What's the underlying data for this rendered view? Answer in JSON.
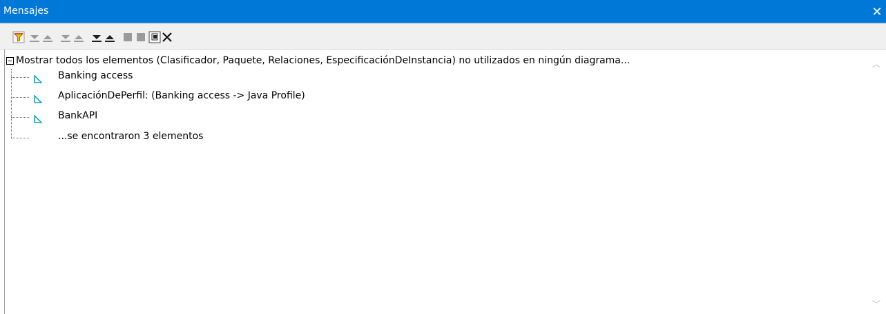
{
  "window": {
    "title": "Mensajes",
    "close_glyph": "✕"
  },
  "toolbar": {
    "buttons": [
      {
        "name": "filter-icon",
        "state": "enabled"
      },
      {
        "name": "next-message-icon",
        "state": "disabled"
      },
      {
        "name": "previous-message-icon",
        "state": "disabled"
      },
      {
        "name": "next-error-icon",
        "state": "disabled"
      },
      {
        "name": "previous-error-icon",
        "state": "disabled"
      },
      {
        "name": "next-warning-icon",
        "state": "enabled"
      },
      {
        "name": "previous-warning-icon",
        "state": "enabled"
      },
      {
        "name": "copy-icon",
        "state": "disabled"
      },
      {
        "name": "copy-all-icon",
        "state": "disabled"
      },
      {
        "name": "find-icon",
        "state": "enabled"
      },
      {
        "name": "clear-icon",
        "state": "enabled"
      }
    ]
  },
  "messages": {
    "root": "Mostrar todos los elementos (Clasificador, Paquete, Relaciones, EspecificaciónDeInstancia) no utilizados en ningún diagrama...",
    "items": [
      {
        "label": "Banking access",
        "icon": "uml-element-icon"
      },
      {
        "label": "AplicaciónDePerfil:  (Banking access -> Java Profile)",
        "icon": "uml-element-icon"
      },
      {
        "label": "BankAPI",
        "icon": "uml-element-icon"
      }
    ],
    "summary": "...se encontraron 3 elementos"
  },
  "scrollbar": {
    "up_glyph": "︿",
    "down_glyph": "﹀"
  },
  "colors": {
    "titlebar": "#0078d7",
    "icon_teal": "#1aa5b5",
    "filter_yellow": "#f2c100",
    "arrow_dark": "#1e1e1e",
    "arrow_disabled": "#9a9a9a"
  }
}
